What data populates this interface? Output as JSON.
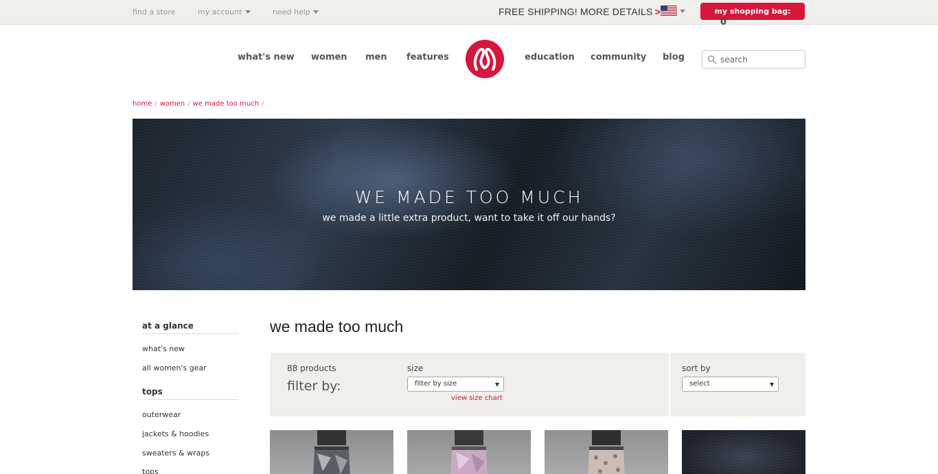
{
  "utility": {
    "find_store": "find a store",
    "my_account": "my account",
    "need_help": "need help",
    "shipping_text": "FREE SHIPPING! MORE DETAILS",
    "shipping_arrow": ">",
    "bag_label": "my shopping bag:",
    "bag_count": "0"
  },
  "nav": {
    "whats_new": "what's new",
    "women": "women",
    "men": "men",
    "features": "features",
    "education": "education",
    "community": "community",
    "blog": "blog",
    "search_placeholder": "search"
  },
  "breadcrumb": [
    "home",
    "women",
    "we made too much"
  ],
  "breadcrumb_sep": "/",
  "hero": {
    "title": "WE MADE TOO MUCH",
    "subtitle": "we made a little extra product, want to take it off our hands?"
  },
  "sidebar": {
    "sections": [
      {
        "heading": "at a glance",
        "items": [
          "what's new",
          "all women's gear"
        ]
      },
      {
        "heading": "tops",
        "items": [
          "outerwear",
          "jackets & hoodies",
          "sweaters & wraps",
          "tops"
        ]
      }
    ]
  },
  "main": {
    "title": "we made too much",
    "product_count": "88 products",
    "filter_by": "filter by:",
    "size_label": "size",
    "size_select": "filter by size",
    "size_chart": "view size chart",
    "sort_label": "sort by",
    "sort_select": "select"
  },
  "colors": {
    "accent": "#d6163a",
    "utility_bg": "#f1efeb",
    "filter_bg": "#f1efeb"
  }
}
